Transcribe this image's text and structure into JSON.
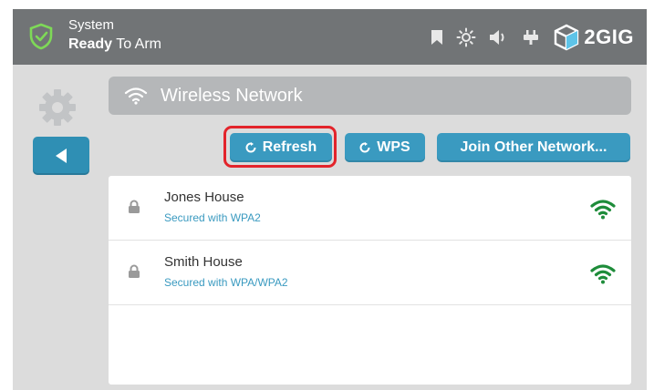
{
  "status_bar": {
    "system_label": "System",
    "status_bold": "Ready",
    "status_rest": " To Arm",
    "icons": [
      "shield-check-icon",
      "bookmark-icon",
      "brightness-icon",
      "volume-icon",
      "power-plug-icon"
    ],
    "brand_text": "2GIG"
  },
  "page": {
    "title": "Wireless Network"
  },
  "actions": {
    "refresh_label": "Refresh",
    "wps_label": "WPS",
    "join_other_label": "Join Other Network..."
  },
  "networks": [
    {
      "name": "Jones House",
      "security": "Secured with WPA2"
    },
    {
      "name": "Smith House",
      "security": "Secured with WPA/WPA2"
    }
  ],
  "colors": {
    "accent": "#3a9ac0",
    "signal": "#1e8c3a",
    "highlight": "#e3242b",
    "header_bg": "#717476"
  }
}
